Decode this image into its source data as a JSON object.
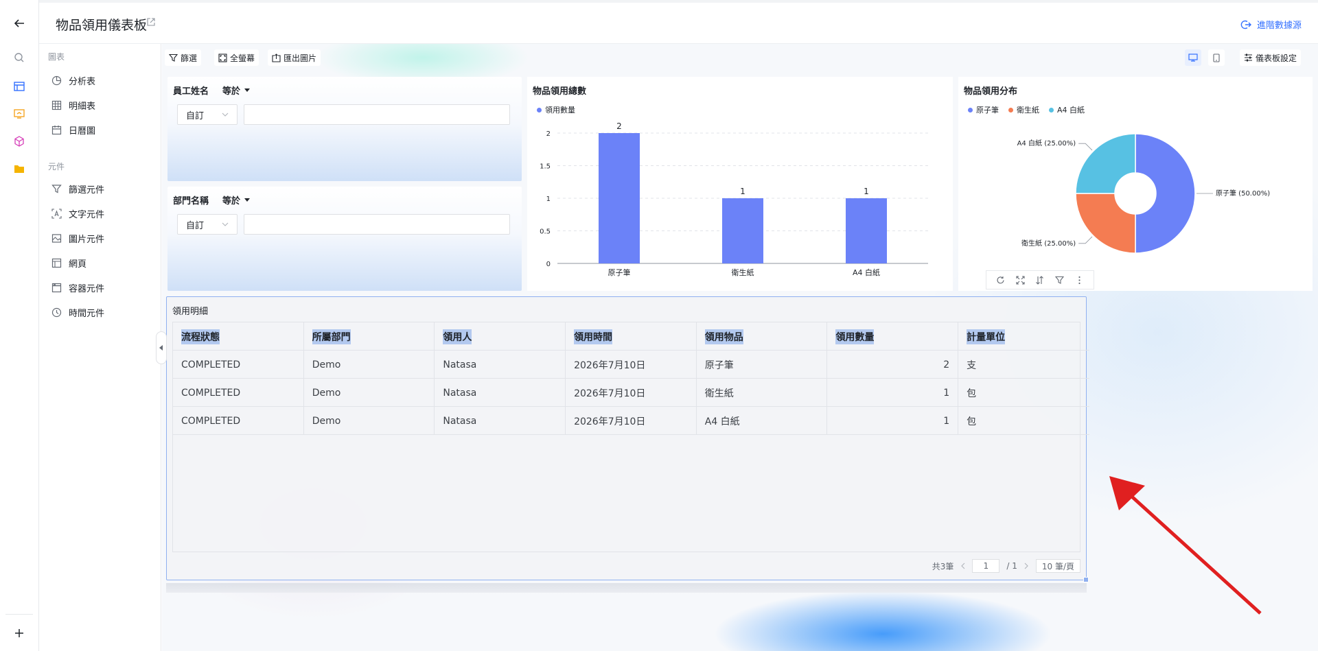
{
  "header": {
    "title": "物品領用儀表板",
    "advanced_link": "進階數據源"
  },
  "panel": {
    "section_charts": "圖表",
    "chart_items": [
      "分析表",
      "明細表",
      "日曆圖"
    ],
    "section_components": "元件",
    "component_items": [
      "篩選元件",
      "文字元件",
      "圖片元件",
      "網頁",
      "容器元件",
      "時間元件"
    ]
  },
  "toolbar": {
    "filter": "篩選",
    "fullscreen": "全螢幕",
    "export_image": "匯出圖片",
    "dashboard_settings": "儀表板設定"
  },
  "filters": [
    {
      "field": "員工姓名",
      "operator": "等於",
      "mode": "自訂",
      "value": ""
    },
    {
      "field": "部門名稱",
      "operator": "等於",
      "mode": "自訂",
      "value": ""
    }
  ],
  "bar_card": {
    "title": "物品領用總數",
    "legend": "領用數量"
  },
  "pie_card": {
    "title": "物品領用分布"
  },
  "chart_data": [
    {
      "type": "bar",
      "title": "物品領用總數",
      "categories": [
        "原子筆",
        "衛生紙",
        "A4 白紙"
      ],
      "series": [
        {
          "name": "領用數量",
          "values": [
            2,
            1,
            1
          ]
        }
      ],
      "ylim": [
        0,
        2
      ],
      "yticks": [
        "0",
        "0.5",
        "1",
        "1.5",
        "2"
      ],
      "grid": true,
      "legend": "top-left"
    },
    {
      "type": "pie",
      "title": "物品領用分布",
      "labels": [
        "原子筆",
        "衛生紙",
        "A4 白紙"
      ],
      "values": [
        2,
        1,
        1
      ],
      "slice_labels": [
        "原子筆 (50.00%)",
        "衛生紙 (25.00%)",
        "A4 白紙 (25.00%)"
      ],
      "colors": [
        "#6b82f8",
        "#f47c52",
        "#57c1e3"
      ],
      "legend": "top-left"
    }
  ],
  "table": {
    "title": "領用明細",
    "columns": [
      "流程狀態",
      "所屬部門",
      "領用人",
      "領用時間",
      "領用物品",
      "領用數量",
      "計量單位"
    ],
    "rows": [
      [
        "COMPLETED",
        "Demo",
        "Natasa",
        "2026年7月10日",
        "原子筆",
        "2",
        "支"
      ],
      [
        "COMPLETED",
        "Demo",
        "Natasa",
        "2026年7月10日",
        "衛生紙",
        "1",
        "包"
      ],
      [
        "COMPLETED",
        "Demo",
        "Natasa",
        "2026年7月10日",
        "A4 白紙",
        "1",
        "包"
      ]
    ],
    "pager": {
      "total": "共3筆",
      "page": "1",
      "pages": "/ 1",
      "page_size": "10 筆/頁"
    }
  },
  "colors": {
    "accent": "#3370ff",
    "bar": "#6b82f8",
    "annotation_arrow": "#e02020"
  }
}
